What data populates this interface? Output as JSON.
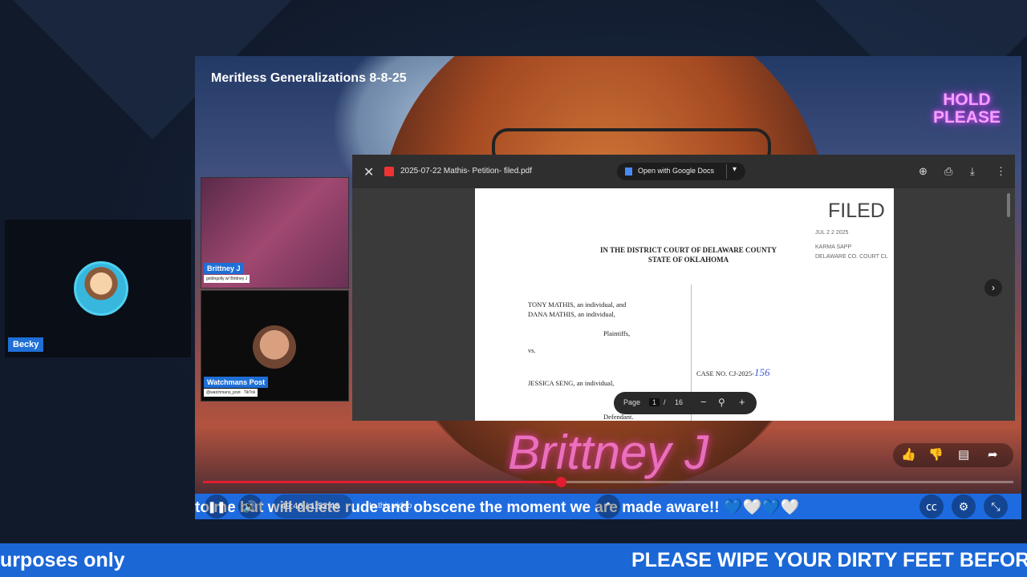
{
  "side_tile": {
    "name": "Becky"
  },
  "video": {
    "title": "Meritless Generalizations 8-8-25",
    "hold_line1": "HOLD",
    "hold_line2": "PLEASE",
    "neon_text": "Brittney J"
  },
  "cams": [
    {
      "name": "Brittney J",
      "subtitle": "goldngolly w/ Brittney J"
    },
    {
      "name": "Watchmans Post",
      "subtitle": "@watchmans_post · TikTok"
    }
  ],
  "pdf": {
    "filename": "2025-07-22 Mathis- Petition- filed.pdf",
    "open_with": "Open with Google Docs",
    "filed": "FILED",
    "stamp_date": "JUL 2 2 2025",
    "stamp_clerk": "KARMA SAPP",
    "stamp_office": "DELAWARE CO. COURT CL",
    "court_line1": "IN THE DISTRICT COURT OF DELAWARE COUNTY",
    "court_line2": "STATE OF OKLAHOMA",
    "plaintiff_line1": "TONY MATHIS, an individual, and",
    "plaintiff_line2": "DANA MATHIS, an individual,",
    "plaintiffs_label": "Plaintiffs,",
    "vs": "vs.",
    "defendant_line": "JESSICA SENG, an individual,",
    "defendant_label": "Defendant.",
    "case_no": "CASE NO. CJ-2025-",
    "case_no_hand": "156",
    "page_label": "Page",
    "page_current": "1",
    "page_sep": "/",
    "page_total": "16"
  },
  "player": {
    "time": "49:46 / 1:52:48",
    "in_this_video": "In this video",
    "progress_fraction": 0.442,
    "ticker": "to me but will delete rude and obscene the moment we are made aware!! 💙🤍💙🤍"
  },
  "banner": {
    "left": "urposes only",
    "right": "PLEASE WIPE YOUR DIRTY FEET BEFOR"
  }
}
